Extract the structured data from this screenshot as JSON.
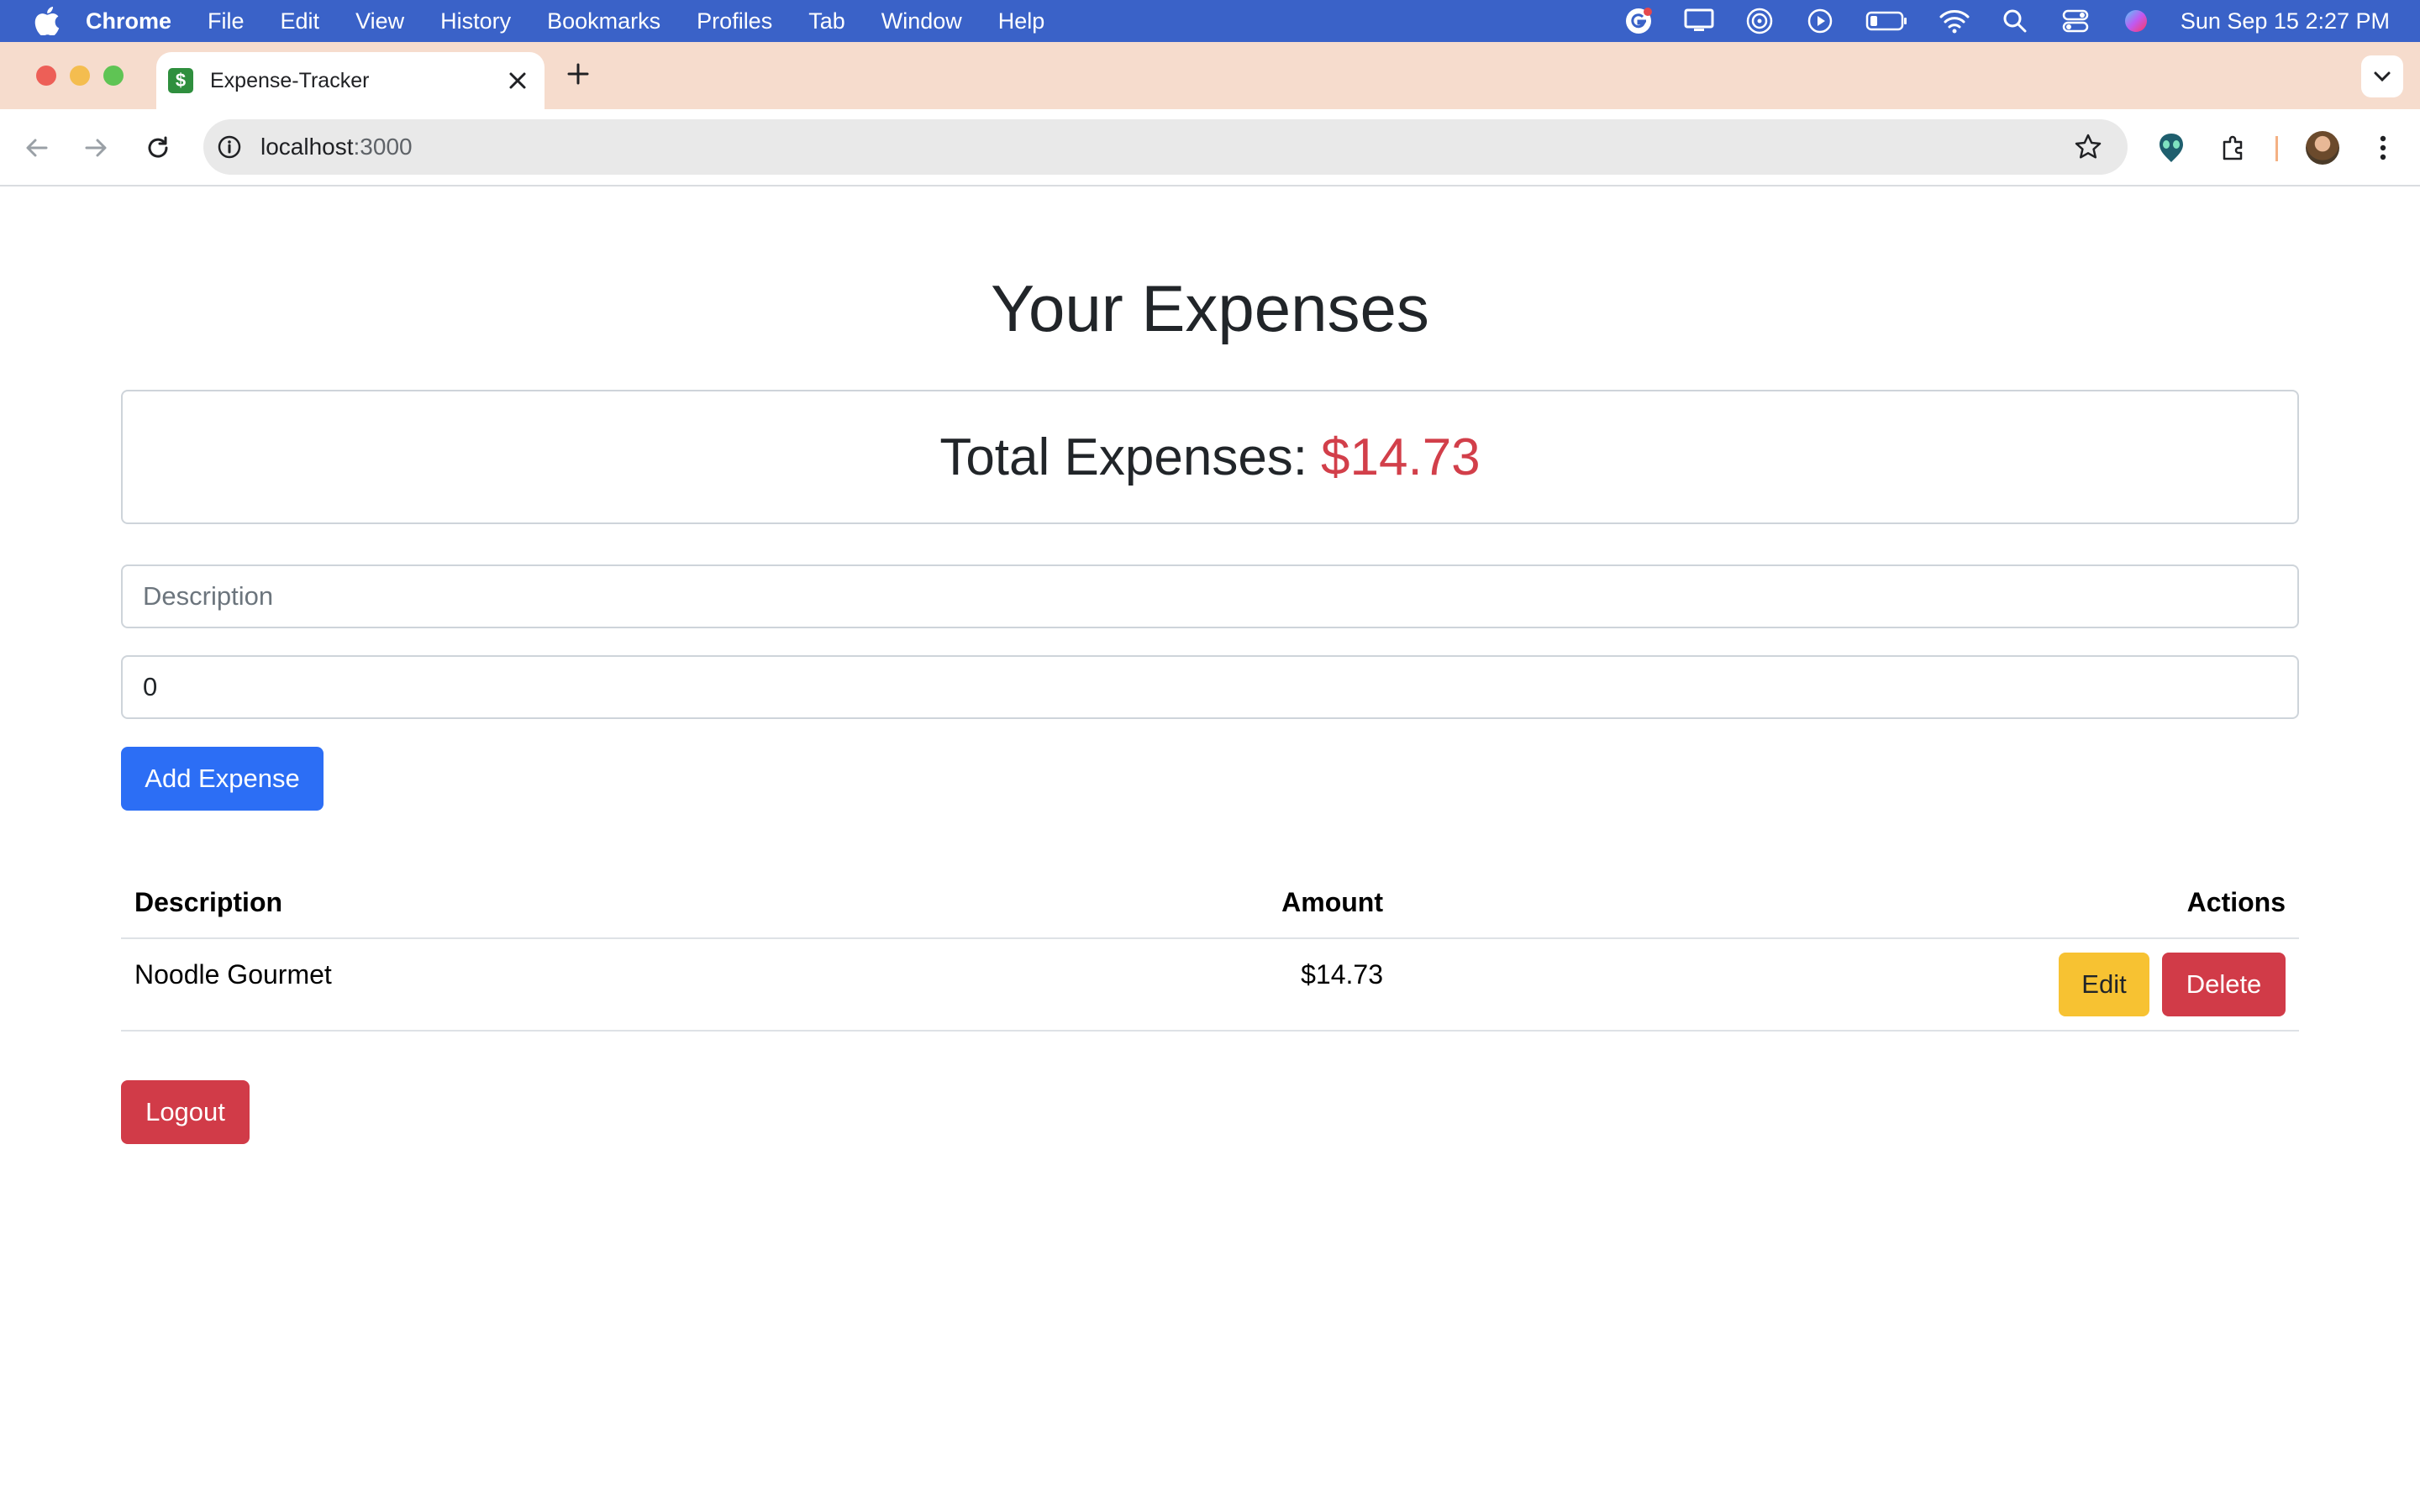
{
  "menubar": {
    "app": "Chrome",
    "items": [
      "File",
      "Edit",
      "View",
      "History",
      "Bookmarks",
      "Profiles",
      "Tab",
      "Window",
      "Help"
    ],
    "clock": "Sun Sep 15  2:27 PM"
  },
  "browser": {
    "tab_title": "Expense-Tracker",
    "favicon_glyph": "$",
    "url_host": "localhost",
    "url_port": ":3000"
  },
  "page": {
    "heading": "Your Expenses",
    "total_label": "Total Expenses:",
    "total_value": "$14.73",
    "description_placeholder": "Description",
    "amount_value": "0",
    "add_button": "Add Expense",
    "logout_button": "Logout",
    "table": {
      "headers": [
        "Description",
        "Amount",
        "Actions"
      ],
      "rows": [
        {
          "description": "Noodle Gourmet",
          "amount": "$14.73",
          "edit": "Edit",
          "delete": "Delete"
        }
      ]
    }
  },
  "colors": {
    "menubar": "#3a62c8",
    "tabstrip": "#f6dccd",
    "primary": "#2c6ef5",
    "danger": "#d13b48",
    "warning": "#f7c232",
    "total_amount": "#d23f4a"
  }
}
